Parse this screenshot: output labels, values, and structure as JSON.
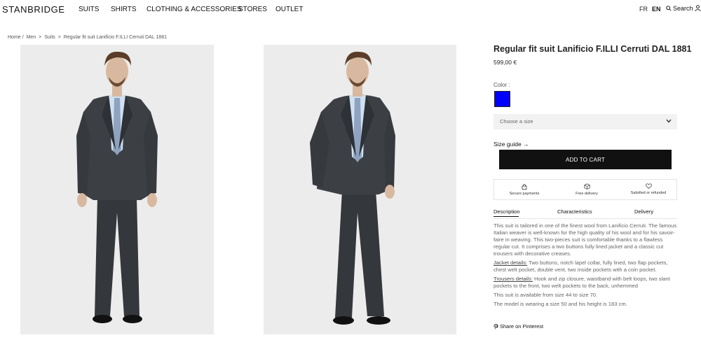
{
  "header": {
    "logo": "STANBRIDGE",
    "nav": [
      "SUITS",
      "SHIRTS",
      "CLOTHING & ACCESSORIES",
      "STORES",
      "OUTLET"
    ],
    "lang_fr": "FR",
    "lang_en": "EN",
    "search_label": "Search",
    "icons": {
      "search": "search-icon",
      "user": "user-icon"
    }
  },
  "breadcrumb": [
    "Home",
    "/",
    "Men",
    ">",
    "Suits",
    ">",
    "Regular fit suit Lanificio F.ILLI Cerruti DAL 1881"
  ],
  "product": {
    "title": "Regular fit suit Lanificio F.ILLI Cerruti DAL 1881",
    "price": "599,00 €",
    "color_label": "Color :",
    "color_swatch": "#0000ff",
    "size_placeholder": "Choose a size",
    "size_guide": "Size guide →",
    "add_to_cart": "ADD TO CART",
    "features": [
      "Secure payments",
      "Free delivery",
      "Satisfied or refunded"
    ],
    "tabs": [
      "Description",
      "Characteristics",
      "Delivery"
    ],
    "description": {
      "intro": "This suit is tailored in one of the finest wool from Lanificio Cerruti. The famous Italian weaver is well-known for the high quality of his wool and for his savoir-faire in weaving. This two-pieces suit is comfortable thanks to a flawless regular cut. It comprises a two buttons fully lined jacket and a classic cut trousers with decorative creases.",
      "jacket_label": "Jacket details:",
      "jacket_text": " Two buttons, notch lapel collar, fully lined, two flap pockets, chest welt pocket, double vent, two inside pockets with a coin pocket.",
      "trousers_label": "Trousers details:",
      "trousers_text": " Hook and zip closure, waistband with belt loops, two slant pockets to the front, two welt pockets to the back, unhemmed",
      "sizes": "This suit is available from size 44 to size 70.",
      "model": "The model is wearing a size 50 and his height is 183 cm."
    },
    "pinterest": "Share on Pinterest"
  },
  "colors": {
    "accent": "#111111",
    "swatch_blue": "#0000ff",
    "photo_bg": "#ececec"
  }
}
